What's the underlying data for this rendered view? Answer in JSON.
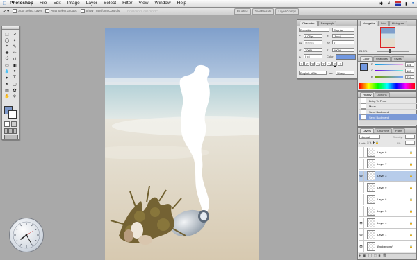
{
  "menubar": {
    "app_name": "Photoshop",
    "items": [
      "File",
      "Edit",
      "Image",
      "Layer",
      "Select",
      "Filter",
      "View",
      "Window",
      "Help"
    ]
  },
  "options_bar": {
    "auto_select_layer": "Auto Select Layer",
    "auto_select_groups": "Auto Select Groups",
    "show_transform_controls": "Show Transform Controls",
    "dock_tabs": [
      "Brushes",
      "Tool Presets",
      "Layer Comps"
    ]
  },
  "character_panel": {
    "tabs": [
      "Character",
      "Paragraph"
    ],
    "font_family": "Eurostile",
    "font_style": "Regular",
    "font_size": "9.08 pt",
    "leading": "(Auto)",
    "kerning": "Metrics",
    "tracking": "0",
    "vertical_scale": "100%",
    "horizontal_scale": "100%",
    "baseline_shift": "0 pt",
    "color_label": "Color:",
    "language": "English: USA",
    "antialias": "Sharp"
  },
  "navigator_panel": {
    "tabs": [
      "Navigator",
      "Info",
      "Histogram"
    ],
    "zoom": "21.5%"
  },
  "color_panel": {
    "tabs": [
      "Color",
      "Swatches",
      "Styles"
    ],
    "channels": [
      {
        "label": "R",
        "value": "114"
      },
      {
        "label": "G",
        "value": "163"
      },
      {
        "label": "B",
        "value": "224"
      }
    ]
  },
  "history_panel": {
    "tabs": [
      "History",
      "Actions"
    ],
    "items": [
      "Bring To Front",
      "Move",
      "Send Backward",
      "Send Backward"
    ],
    "selected_index": 3
  },
  "layers_panel": {
    "tabs": [
      "Layers",
      "Channels",
      "Paths"
    ],
    "blend_mode": "Normal",
    "opacity_label": "Opacity:",
    "lock_label": "Lock:",
    "fill_label": "Fill:",
    "layers": [
      {
        "name": "Layer 6",
        "visible": false,
        "selected": false
      },
      {
        "name": "Layer 7",
        "visible": false,
        "selected": false
      },
      {
        "name": "Layer 3",
        "visible": true,
        "selected": true
      },
      {
        "name": "Layer 9",
        "visible": false,
        "selected": false
      },
      {
        "name": "Layer 8",
        "visible": false,
        "selected": false
      },
      {
        "name": "Layer 5",
        "visible": false,
        "selected": false
      },
      {
        "name": "Layer 4",
        "visible": true,
        "selected": false
      },
      {
        "name": "Layer 1",
        "visible": true,
        "selected": false
      },
      {
        "name": "Background",
        "visible": true,
        "selected": false
      }
    ]
  },
  "colors": {
    "foreground": "#7298e0",
    "background": "#ffffff",
    "selection": "#b7ccea",
    "history_selection": "#7c9ad6"
  }
}
